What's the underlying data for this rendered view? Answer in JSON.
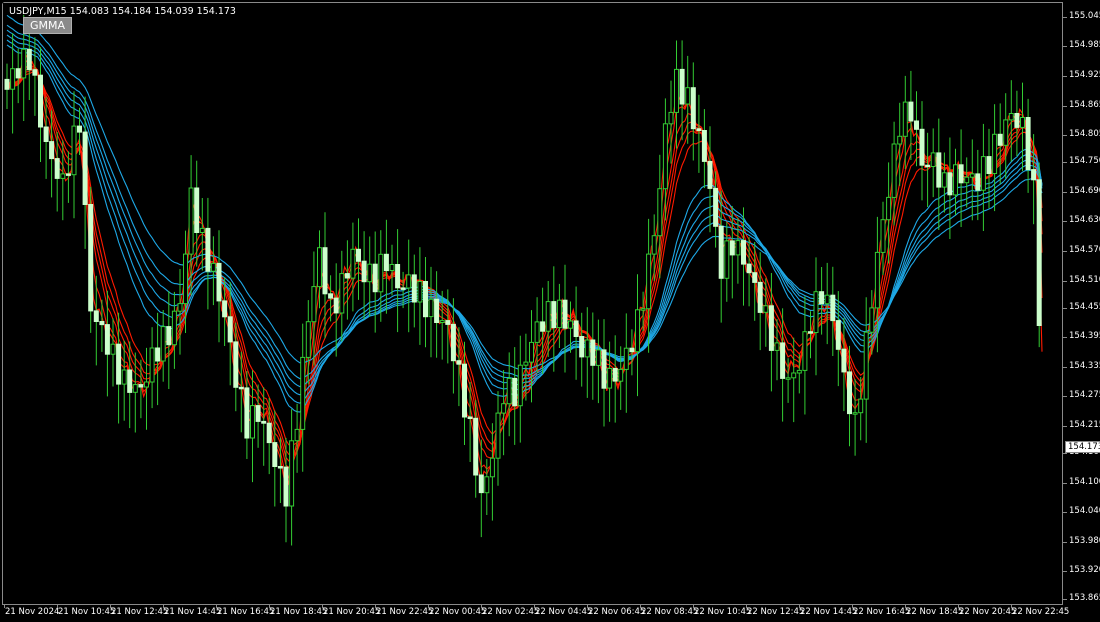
{
  "window": {
    "symbol_info": "USDJPY,M15  154.083 154.184 154.039 154.173",
    "indicator_label": "GMMA",
    "current_price_label": "154.173"
  },
  "colors": {
    "background": "#000000",
    "candle_body": "#ccffcc",
    "candle_wick": "#33cc33",
    "short_ema": "#ff1a00",
    "long_ema": "#1ea8e6"
  },
  "chart_data": {
    "type": "candlestick",
    "symbol": "USDJPY",
    "timeframe": "M15",
    "ylim": [
      153.86,
      155.075
    ],
    "grid": false,
    "price_ticks": [
      "155.045",
      "154.985",
      "154.925",
      "154.865",
      "154.805",
      "154.750",
      "154.690",
      "154.630",
      "154.570",
      "154.510",
      "154.455",
      "154.395",
      "154.335",
      "154.275",
      "154.215",
      "154.160",
      "154.100",
      "154.040",
      "153.980",
      "153.920",
      "153.865"
    ],
    "time_ticks": [
      "21 Nov 2024",
      "21 Nov 10:45",
      "21 Nov 12:45",
      "21 Nov 14:45",
      "21 Nov 16:45",
      "21 Nov 18:45",
      "21 Nov 20:45",
      "21 Nov 22:45",
      "22 Nov 00:45",
      "22 Nov 02:45",
      "22 Nov 04:45",
      "22 Nov 06:45",
      "22 Nov 08:45",
      "22 Nov 10:45",
      "22 Nov 12:45",
      "22 Nov 14:45",
      "22 Nov 16:45",
      "22 Nov 18:45",
      "22 Nov 20:45",
      "22 Nov 22:45"
    ],
    "close_path": [
      [
        0,
        154.9
      ],
      [
        8,
        154.98
      ],
      [
        14,
        154.8
      ],
      [
        20,
        154.7
      ],
      [
        26,
        154.82
      ],
      [
        30,
        154.45
      ],
      [
        36,
        154.4
      ],
      [
        42,
        154.32
      ],
      [
        48,
        154.28
      ],
      [
        54,
        154.36
      ],
      [
        58,
        154.4
      ],
      [
        62,
        154.48
      ],
      [
        66,
        154.7
      ],
      [
        70,
        154.6
      ],
      [
        74,
        154.52
      ],
      [
        78,
        154.42
      ],
      [
        82,
        154.3
      ],
      [
        86,
        154.22
      ],
      [
        90,
        154.26
      ],
      [
        94,
        154.2
      ],
      [
        98,
        154.12
      ],
      [
        100,
        154.08
      ],
      [
        104,
        154.22
      ],
      [
        108,
        154.42
      ],
      [
        112,
        154.56
      ],
      [
        116,
        154.46
      ],
      [
        120,
        154.52
      ],
      [
        124,
        154.58
      ],
      [
        128,
        154.52
      ],
      [
        132,
        154.5
      ],
      [
        136,
        154.54
      ],
      [
        140,
        154.5
      ],
      [
        144,
        154.52
      ],
      [
        148,
        154.5
      ],
      [
        150,
        154.48
      ],
      [
        154,
        154.44
      ],
      [
        158,
        154.4
      ],
      [
        162,
        154.3
      ],
      [
        166,
        154.2
      ],
      [
        170,
        154.08
      ],
      [
        174,
        154.18
      ],
      [
        178,
        154.3
      ],
      [
        182,
        154.28
      ],
      [
        186,
        154.34
      ],
      [
        190,
        154.4
      ],
      [
        194,
        154.44
      ],
      [
        198,
        154.46
      ],
      [
        202,
        154.44
      ],
      [
        206,
        154.38
      ],
      [
        210,
        154.36
      ],
      [
        214,
        154.3
      ],
      [
        218,
        154.3
      ],
      [
        222,
        154.36
      ],
      [
        226,
        154.44
      ],
      [
        230,
        154.56
      ],
      [
        234,
        154.7
      ],
      [
        236,
        154.82
      ],
      [
        240,
        154.9
      ],
      [
        244,
        154.86
      ],
      [
        248,
        154.8
      ],
      [
        252,
        154.72
      ],
      [
        254,
        154.62
      ],
      [
        256,
        154.56
      ],
      [
        260,
        154.6
      ],
      [
        264,
        154.55
      ],
      [
        268,
        154.48
      ],
      [
        272,
        154.42
      ],
      [
        276,
        154.36
      ],
      [
        280,
        154.32
      ],
      [
        284,
        154.36
      ],
      [
        288,
        154.44
      ],
      [
        292,
        154.48
      ],
      [
        296,
        154.42
      ],
      [
        300,
        154.3
      ],
      [
        304,
        154.22
      ],
      [
        308,
        154.4
      ],
      [
        312,
        154.58
      ],
      [
        316,
        154.7
      ],
      [
        320,
        154.82
      ],
      [
        324,
        154.84
      ],
      [
        328,
        154.74
      ],
      [
        332,
        154.76
      ],
      [
        336,
        154.72
      ],
      [
        340,
        154.74
      ],
      [
        344,
        154.72
      ],
      [
        348,
        154.7
      ],
      [
        352,
        154.74
      ],
      [
        356,
        154.8
      ],
      [
        360,
        154.86
      ],
      [
        364,
        154.84
      ],
      [
        366,
        154.78
      ],
      [
        369,
        154.66
      ],
      [
        370,
        154.45
      ],
      [
        371,
        154.17
      ]
    ],
    "series": [
      {
        "name": "",
        "group": "short",
        "periods": [
          3,
          5,
          8,
          10,
          12,
          15
        ]
      },
      {
        "name": "",
        "group": "long",
        "periods": [
          30,
          35,
          40,
          45,
          50,
          60
        ]
      }
    ]
  }
}
